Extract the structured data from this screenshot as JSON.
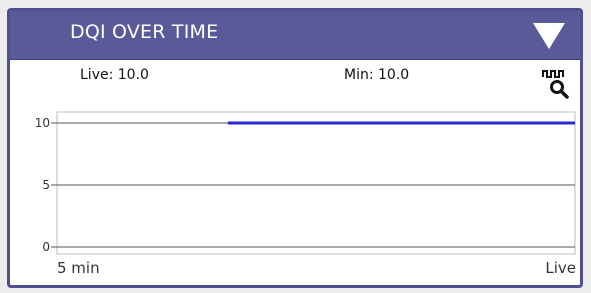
{
  "widget": {
    "title": "DQI OVER TIME",
    "collapse_icon": "triangle-down-icon"
  },
  "stats": {
    "live_label": "Live: 10.0",
    "min_label": "Min: 10.0",
    "zoom_icon": "waveform-zoom-icon"
  },
  "colors": {
    "header": "#5a5a9a",
    "border": "#50508e",
    "series": "#2a2acc"
  },
  "chart_data": {
    "type": "line",
    "x_tick_labels": [
      "5 min",
      "Live"
    ],
    "y_ticks": [
      {
        "value": 0,
        "label": "0"
      },
      {
        "value": 5,
        "label": "5"
      },
      {
        "value": 10,
        "label": "10"
      }
    ],
    "ylim": [
      0,
      10
    ],
    "grid": true,
    "series": [
      {
        "x_start_fraction": 0.33,
        "x_end_fraction": 1.0,
        "value": 10
      }
    ]
  }
}
